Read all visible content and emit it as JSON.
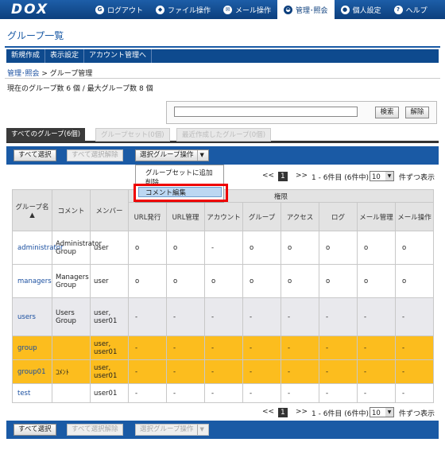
{
  "app": {
    "logo": "DOX"
  },
  "nav": [
    {
      "icon": "G",
      "label": "ログアウト",
      "active": false
    },
    {
      "icon": "◆",
      "label": "ファイル操作",
      "active": false
    },
    {
      "icon": "✉",
      "label": "メール操作",
      "active": false
    },
    {
      "icon": "◒",
      "label": "管理･照会",
      "active": true
    },
    {
      "icon": "●",
      "label": "個人設定",
      "active": false
    },
    {
      "icon": "?",
      "label": "ヘルプ",
      "active": false
    }
  ],
  "page": {
    "title": "グループ一覧",
    "menu": [
      "新規作成",
      "表示設定",
      "アカウント管理へ"
    ],
    "breadcrumb_link": "管理･照会",
    "breadcrumb_sep": " > ",
    "breadcrumb_current": "グループ管理",
    "counts": "現在のグループ数 6 個 / 最大グループ数 8 個"
  },
  "search": {
    "value": "",
    "search_label": "検索",
    "clear_label": "解除"
  },
  "tabs": [
    "すべてのグループ(6個)",
    "グループセット(0個)",
    "最近作成したグループ(0個)"
  ],
  "toolbar": {
    "select_all": "すべて選択",
    "deselect_all": "すべて選択解除",
    "group_action": "選択グループ操作"
  },
  "dropdown": {
    "items": [
      "グループセットに追加",
      "削除",
      "コメント編集"
    ]
  },
  "pager": {
    "prev": "<<",
    "page": "1",
    "next": ">>",
    "range": "1 - 6件目 (6件中)",
    "per_page": "10",
    "per_page_suffix": "件ずつ表示"
  },
  "table": {
    "headers": {
      "group_name": "グループ名",
      "comment": "コメント",
      "members": "メンバー",
      "permissions": "権限"
    },
    "perm_headers": [
      "URL発行",
      "URL管理",
      "アカウント",
      "グループ",
      "アクセス",
      "ログ",
      "メール管理",
      "メール操作"
    ],
    "rows": [
      {
        "name": "administrator",
        "comment": "Administrator Group",
        "members": "user",
        "perms": [
          "o",
          "o",
          "-",
          "o",
          "o",
          "o",
          "o",
          "o"
        ],
        "style": "white"
      },
      {
        "name": "managers",
        "comment": "Managers Group",
        "members": "user",
        "perms": [
          "o",
          "o",
          "o",
          "o",
          "o",
          "o",
          "o",
          "o"
        ],
        "style": "white"
      },
      {
        "name": "users",
        "comment": "Users Group",
        "members": "user, user01",
        "perms": [
          "-",
          "-",
          "-",
          "-",
          "-",
          "-",
          "-",
          "-"
        ],
        "style": "grey"
      },
      {
        "name": "group",
        "comment": "",
        "members": "user, user01",
        "perms": [
          "-",
          "-",
          "-",
          "-",
          "-",
          "-",
          "-",
          "-"
        ],
        "style": "yel"
      },
      {
        "name": "group01",
        "comment": "ｺﾒﾝﾄ",
        "members": "user, user01",
        "perms": [
          "-",
          "-",
          "-",
          "-",
          "-",
          "-",
          "-",
          "-"
        ],
        "style": "yel"
      },
      {
        "name": "test",
        "comment": "",
        "members": "user01",
        "perms": [
          "-",
          "-",
          "-",
          "-",
          "-",
          "-",
          "-",
          "-"
        ],
        "style": "white"
      }
    ]
  }
}
